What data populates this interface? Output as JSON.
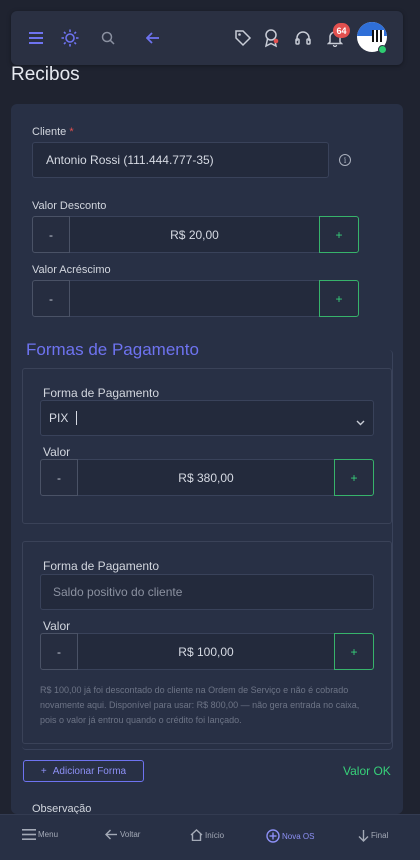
{
  "topbar": {
    "notifications_count": "64",
    "icons": [
      "menu-icon",
      "sun-icon",
      "search-icon",
      "arrow-left-icon",
      "tag-icon",
      "award-icon",
      "headset-icon",
      "bell-icon"
    ]
  },
  "page": {
    "title": "Recibos"
  },
  "form": {
    "cliente_label": "Cliente",
    "required_mark": "*",
    "cliente_value": "Antonio Rossi (111.444.777-35)",
    "info_glyph": "i",
    "desconto_label": "Valor Desconto",
    "desconto_value": "R$ 20,00",
    "acrescimo_label": "Valor Acréscimo",
    "acrescimo_value": "",
    "stepper_minus": "-",
    "stepper_plus": "+"
  },
  "payments": {
    "section_title": "Formas de Pagamento",
    "items": [
      {
        "forma_label": "Forma de Pagamento",
        "forma_value": "PIX",
        "valor_label": "Valor",
        "valor_value": "R$ 380,00"
      },
      {
        "forma_label": "Forma de Pagamento",
        "forma_placeholder": "Saldo positivo do cliente",
        "valor_label": "Valor",
        "valor_value": "R$ 100,00",
        "help": "R$ 100,00 já foi descontado do cliente na Ordem de Serviço e não é cobrado novamente aqui. Disponível para usar: R$ 800,00 — não gera entrada no caixa, pois o valor já entrou quando o crédito foi lançado."
      }
    ],
    "add_button": "Adicionar Forma",
    "add_plus": "+",
    "status": "Valor OK"
  },
  "cut_label": "Observação",
  "bottom_nav": [
    {
      "label": "Menu",
      "icon": "menu-icon"
    },
    {
      "label": "Voltar",
      "icon": "arrow-left-icon"
    },
    {
      "label": "Início",
      "icon": "home-icon"
    },
    {
      "label": "Nova OS",
      "icon": "plus-circle-icon",
      "active": true
    },
    {
      "label": "Final",
      "icon": "arrow-down-icon"
    }
  ],
  "colors": {
    "accent": "#6e73f0",
    "success": "#37d17a",
    "danger": "#e2504f",
    "background": "#1f2330",
    "card": "#283045"
  }
}
